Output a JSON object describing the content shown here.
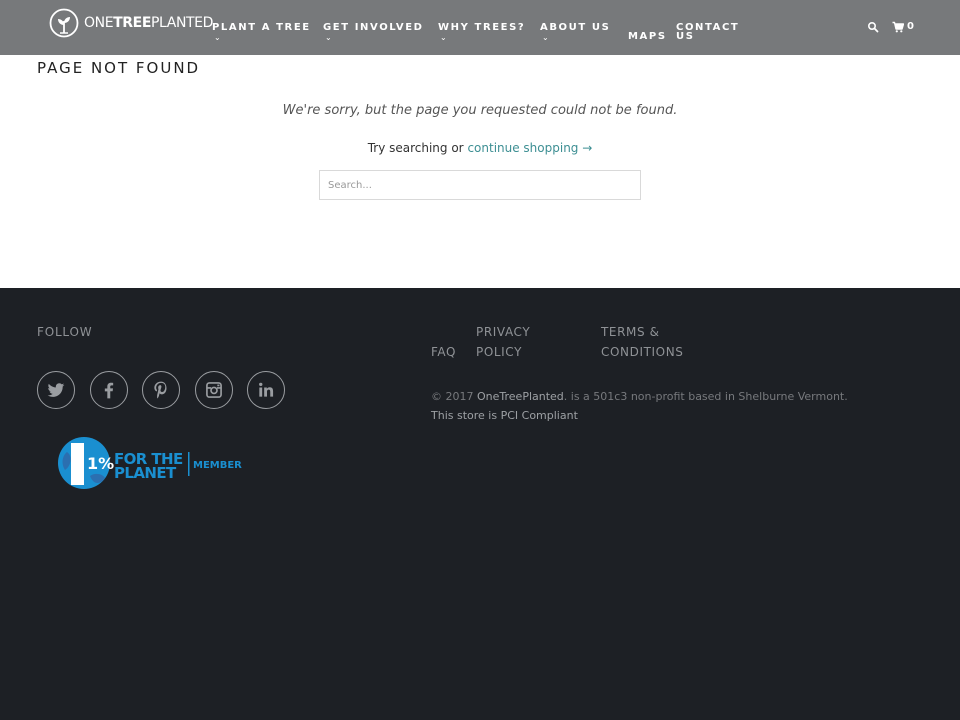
{
  "header": {
    "logo_text_light": "ONE",
    "logo_text_bold": "TREE",
    "logo_text_end": "PLANTED",
    "nav": [
      {
        "label": "PLANT A TREE",
        "chevron": "⌄"
      },
      {
        "label": "GET INVOLVED",
        "chevron": "⌄"
      },
      {
        "label": "WHY TREES?",
        "chevron": "⌄"
      },
      {
        "label": "ABOUT US",
        "chevron": "⌄"
      },
      {
        "label": "MAPS"
      },
      {
        "label": "CONTACT US"
      }
    ],
    "cart_count": "0",
    "icons": {
      "search": "search-icon",
      "cart": "cart-icon"
    }
  },
  "main": {
    "title": "PAGE NOT FOUND",
    "sorry_text": "We're sorry, but the page you requested could not be found.",
    "try_text": "Try searching or ",
    "continue_link": "continue shopping →",
    "search_placeholder": "Search...",
    "link_color": "#3d8f93"
  },
  "footer": {
    "follow_label": "FOLLOW",
    "social": [
      "twitter-icon",
      "facebook-icon",
      "pinterest-icon",
      "instagram-icon",
      "linkedin-icon"
    ],
    "badge": {
      "percent": "1%",
      "line1": "FOR THE",
      "line2": "PLANET",
      "member": "MEMBER"
    },
    "links": {
      "faq": "FAQ",
      "privacy": "PRIVACY POLICY",
      "terms": "TERMS & CONDITIONS"
    },
    "copyright_prefix": "© 2017 ",
    "copyright_brand": "OneTreePlanted",
    "copyright_suffix": ". is a 501c3 non-profit based in Shelburne Vermont.",
    "pci": "This store is PCI Compliant",
    "background": "#1d2025"
  }
}
